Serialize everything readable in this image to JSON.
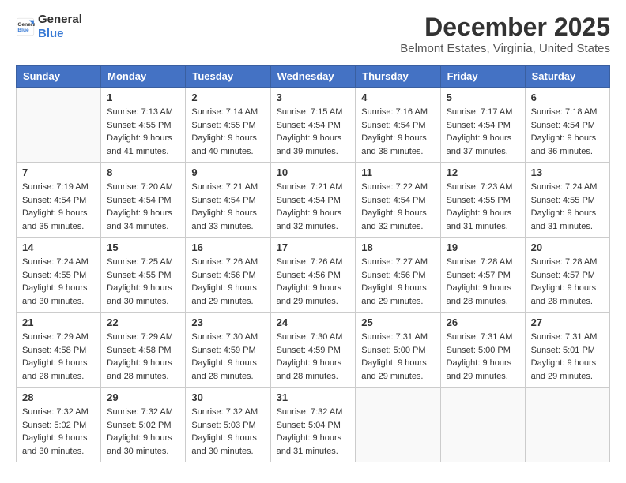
{
  "logo": {
    "text_general": "General",
    "text_blue": "Blue"
  },
  "header": {
    "month": "December 2025",
    "location": "Belmont Estates, Virginia, United States"
  },
  "days_of_week": [
    "Sunday",
    "Monday",
    "Tuesday",
    "Wednesday",
    "Thursday",
    "Friday",
    "Saturday"
  ],
  "weeks": [
    [
      {
        "day": "",
        "sunrise": "",
        "sunset": "",
        "daylight": ""
      },
      {
        "day": "1",
        "sunrise": "Sunrise: 7:13 AM",
        "sunset": "Sunset: 4:55 PM",
        "daylight": "Daylight: 9 hours and 41 minutes."
      },
      {
        "day": "2",
        "sunrise": "Sunrise: 7:14 AM",
        "sunset": "Sunset: 4:55 PM",
        "daylight": "Daylight: 9 hours and 40 minutes."
      },
      {
        "day": "3",
        "sunrise": "Sunrise: 7:15 AM",
        "sunset": "Sunset: 4:54 PM",
        "daylight": "Daylight: 9 hours and 39 minutes."
      },
      {
        "day": "4",
        "sunrise": "Sunrise: 7:16 AM",
        "sunset": "Sunset: 4:54 PM",
        "daylight": "Daylight: 9 hours and 38 minutes."
      },
      {
        "day": "5",
        "sunrise": "Sunrise: 7:17 AM",
        "sunset": "Sunset: 4:54 PM",
        "daylight": "Daylight: 9 hours and 37 minutes."
      },
      {
        "day": "6",
        "sunrise": "Sunrise: 7:18 AM",
        "sunset": "Sunset: 4:54 PM",
        "daylight": "Daylight: 9 hours and 36 minutes."
      }
    ],
    [
      {
        "day": "7",
        "sunrise": "Sunrise: 7:19 AM",
        "sunset": "Sunset: 4:54 PM",
        "daylight": "Daylight: 9 hours and 35 minutes."
      },
      {
        "day": "8",
        "sunrise": "Sunrise: 7:20 AM",
        "sunset": "Sunset: 4:54 PM",
        "daylight": "Daylight: 9 hours and 34 minutes."
      },
      {
        "day": "9",
        "sunrise": "Sunrise: 7:21 AM",
        "sunset": "Sunset: 4:54 PM",
        "daylight": "Daylight: 9 hours and 33 minutes."
      },
      {
        "day": "10",
        "sunrise": "Sunrise: 7:21 AM",
        "sunset": "Sunset: 4:54 PM",
        "daylight": "Daylight: 9 hours and 32 minutes."
      },
      {
        "day": "11",
        "sunrise": "Sunrise: 7:22 AM",
        "sunset": "Sunset: 4:54 PM",
        "daylight": "Daylight: 9 hours and 32 minutes."
      },
      {
        "day": "12",
        "sunrise": "Sunrise: 7:23 AM",
        "sunset": "Sunset: 4:55 PM",
        "daylight": "Daylight: 9 hours and 31 minutes."
      },
      {
        "day": "13",
        "sunrise": "Sunrise: 7:24 AM",
        "sunset": "Sunset: 4:55 PM",
        "daylight": "Daylight: 9 hours and 31 minutes."
      }
    ],
    [
      {
        "day": "14",
        "sunrise": "Sunrise: 7:24 AM",
        "sunset": "Sunset: 4:55 PM",
        "daylight": "Daylight: 9 hours and 30 minutes."
      },
      {
        "day": "15",
        "sunrise": "Sunrise: 7:25 AM",
        "sunset": "Sunset: 4:55 PM",
        "daylight": "Daylight: 9 hours and 30 minutes."
      },
      {
        "day": "16",
        "sunrise": "Sunrise: 7:26 AM",
        "sunset": "Sunset: 4:56 PM",
        "daylight": "Daylight: 9 hours and 29 minutes."
      },
      {
        "day": "17",
        "sunrise": "Sunrise: 7:26 AM",
        "sunset": "Sunset: 4:56 PM",
        "daylight": "Daylight: 9 hours and 29 minutes."
      },
      {
        "day": "18",
        "sunrise": "Sunrise: 7:27 AM",
        "sunset": "Sunset: 4:56 PM",
        "daylight": "Daylight: 9 hours and 29 minutes."
      },
      {
        "day": "19",
        "sunrise": "Sunrise: 7:28 AM",
        "sunset": "Sunset: 4:57 PM",
        "daylight": "Daylight: 9 hours and 28 minutes."
      },
      {
        "day": "20",
        "sunrise": "Sunrise: 7:28 AM",
        "sunset": "Sunset: 4:57 PM",
        "daylight": "Daylight: 9 hours and 28 minutes."
      }
    ],
    [
      {
        "day": "21",
        "sunrise": "Sunrise: 7:29 AM",
        "sunset": "Sunset: 4:58 PM",
        "daylight": "Daylight: 9 hours and 28 minutes."
      },
      {
        "day": "22",
        "sunrise": "Sunrise: 7:29 AM",
        "sunset": "Sunset: 4:58 PM",
        "daylight": "Daylight: 9 hours and 28 minutes."
      },
      {
        "day": "23",
        "sunrise": "Sunrise: 7:30 AM",
        "sunset": "Sunset: 4:59 PM",
        "daylight": "Daylight: 9 hours and 28 minutes."
      },
      {
        "day": "24",
        "sunrise": "Sunrise: 7:30 AM",
        "sunset": "Sunset: 4:59 PM",
        "daylight": "Daylight: 9 hours and 28 minutes."
      },
      {
        "day": "25",
        "sunrise": "Sunrise: 7:31 AM",
        "sunset": "Sunset: 5:00 PM",
        "daylight": "Daylight: 9 hours and 29 minutes."
      },
      {
        "day": "26",
        "sunrise": "Sunrise: 7:31 AM",
        "sunset": "Sunset: 5:00 PM",
        "daylight": "Daylight: 9 hours and 29 minutes."
      },
      {
        "day": "27",
        "sunrise": "Sunrise: 7:31 AM",
        "sunset": "Sunset: 5:01 PM",
        "daylight": "Daylight: 9 hours and 29 minutes."
      }
    ],
    [
      {
        "day": "28",
        "sunrise": "Sunrise: 7:32 AM",
        "sunset": "Sunset: 5:02 PM",
        "daylight": "Daylight: 9 hours and 30 minutes."
      },
      {
        "day": "29",
        "sunrise": "Sunrise: 7:32 AM",
        "sunset": "Sunset: 5:02 PM",
        "daylight": "Daylight: 9 hours and 30 minutes."
      },
      {
        "day": "30",
        "sunrise": "Sunrise: 7:32 AM",
        "sunset": "Sunset: 5:03 PM",
        "daylight": "Daylight: 9 hours and 30 minutes."
      },
      {
        "day": "31",
        "sunrise": "Sunrise: 7:32 AM",
        "sunset": "Sunset: 5:04 PM",
        "daylight": "Daylight: 9 hours and 31 minutes."
      },
      {
        "day": "",
        "sunrise": "",
        "sunset": "",
        "daylight": ""
      },
      {
        "day": "",
        "sunrise": "",
        "sunset": "",
        "daylight": ""
      },
      {
        "day": "",
        "sunrise": "",
        "sunset": "",
        "daylight": ""
      }
    ]
  ]
}
